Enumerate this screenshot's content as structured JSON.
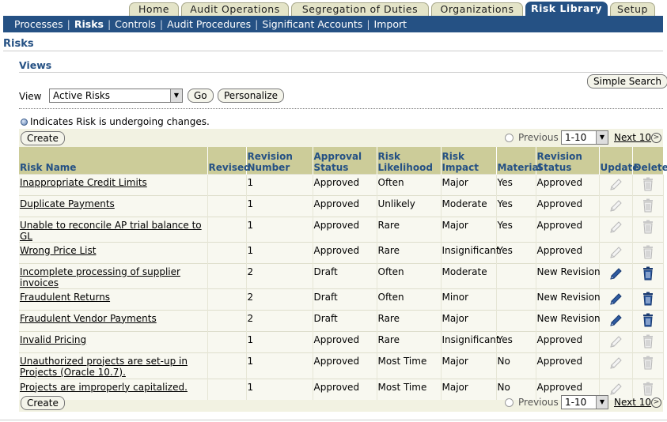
{
  "tabs": [
    "Home",
    "Audit Operations",
    "Segregation of Duties",
    "Organizations",
    "Risk Library",
    "Setup"
  ],
  "subnav": [
    "Processes",
    "Risks",
    "Controls",
    "Audit Procedures",
    "Significant Accounts",
    "Import"
  ],
  "page_title": "Risks",
  "views_title": "Views",
  "simple_search_label": "Simple Search",
  "view_label": "View",
  "view_value": "Active Risks",
  "go_label": "Go",
  "personalize_label": "Personalize",
  "indicator_text": "Indicates Risk is undergoing changes.",
  "create_label": "Create",
  "pager": {
    "previous": "Previous",
    "range": "1-10",
    "next": "Next 10"
  },
  "columns": [
    "Risk Name",
    "Revised",
    "Revision Number",
    "Approval Status",
    "Risk Likelihood",
    "Risk Impact",
    "Material",
    "Revision Status",
    "Update",
    "Delete"
  ],
  "rows": [
    {
      "name": "Inappropriate Credit Limits",
      "revised": "",
      "revnum": "1",
      "approval": "Approved",
      "likelihood": "Often",
      "impact": "Major",
      "material": "Yes",
      "revstatus": "Approved",
      "editable": false
    },
    {
      "name": "Duplicate Payments",
      "revised": "",
      "revnum": "1",
      "approval": "Approved",
      "likelihood": "Unlikely",
      "impact": "Moderate",
      "material": "Yes",
      "revstatus": "Approved",
      "editable": false
    },
    {
      "name": "Unable to reconcile AP trial balance to GL",
      "revised": "",
      "revnum": "1",
      "approval": "Approved",
      "likelihood": "Rare",
      "impact": "Major",
      "material": "Yes",
      "revstatus": "Approved",
      "editable": false
    },
    {
      "name": "Wrong Price List",
      "revised": "",
      "revnum": "1",
      "approval": "Approved",
      "likelihood": "Rare",
      "impact": "Insignificant",
      "material": "Yes",
      "revstatus": "Approved",
      "editable": false
    },
    {
      "name": "Incomplete processing of supplier invoices",
      "revised": "",
      "revnum": "2",
      "approval": "Draft",
      "likelihood": "Often",
      "impact": "Moderate",
      "material": "",
      "revstatus": "New Revision",
      "editable": true
    },
    {
      "name": "Fraudulent Returns",
      "revised": "",
      "revnum": "2",
      "approval": "Draft",
      "likelihood": "Often",
      "impact": "Minor",
      "material": "",
      "revstatus": "New Revision",
      "editable": true
    },
    {
      "name": "Fraudulent Vendor Payments",
      "revised": "",
      "revnum": "2",
      "approval": "Draft",
      "likelihood": "Rare",
      "impact": "Major",
      "material": "",
      "revstatus": "New Revision",
      "editable": true
    },
    {
      "name": "Invalid Pricing",
      "revised": "",
      "revnum": "1",
      "approval": "Approved",
      "likelihood": "Rare",
      "impact": "Insignificant",
      "material": "Yes",
      "revstatus": "Approved",
      "editable": false
    },
    {
      "name": "Unauthorized projects are set-up in Projects (Oracle 10.7).",
      "revised": "",
      "revnum": "1",
      "approval": "Approved",
      "likelihood": "Most Time",
      "impact": "Major",
      "material": "No",
      "revstatus": "Approved",
      "editable": false
    },
    {
      "name": "Projects are improperly capitalized.",
      "revised": "",
      "revnum": "1",
      "approval": "Approved",
      "likelihood": "Most Time",
      "impact": "Major",
      "material": "No",
      "revstatus": "Approved",
      "editable": false
    }
  ],
  "colors": {
    "nav_blue": "#255184",
    "header_tan": "#cccc99",
    "panel_bg": "#f2f2e2",
    "tab_bg": "#e4e4c8"
  },
  "icons": {
    "update": "pencil-icon",
    "delete": "trash-icon",
    "indicator": "blue-dot-icon",
    "next": "next-arrow-icon"
  }
}
